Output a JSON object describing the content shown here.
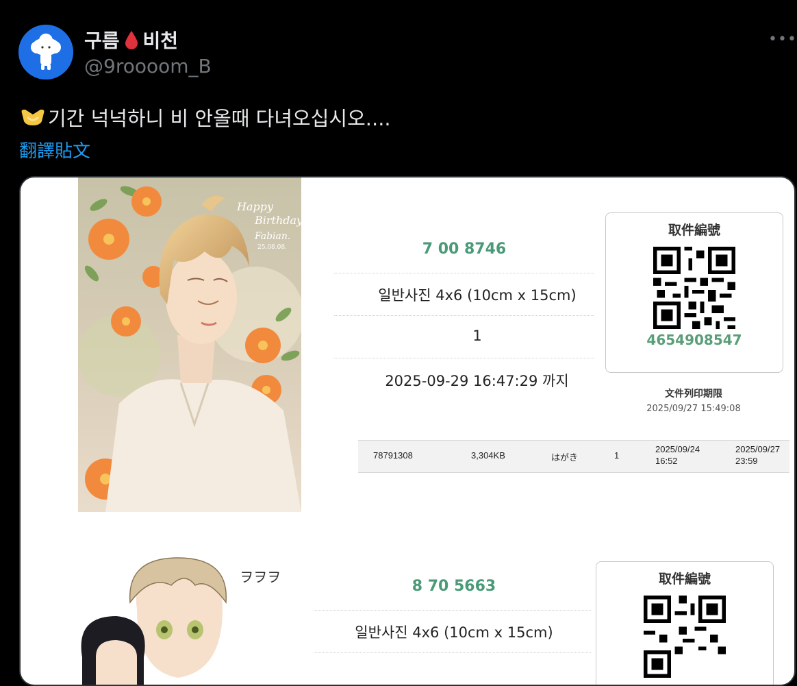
{
  "tweet": {
    "display_name_part1": "구름",
    "display_name_part2": "비천",
    "handle": "@9roooom_B",
    "text": "기간 넉넉하니 비 안올때 다녀오십시오....",
    "translate_label": "翻譯貼文",
    "more_icon": "more-dots-icon",
    "heart_color": "#f5c742"
  },
  "receipt1": {
    "code": "7 00 8746",
    "product": "일반사진 4x6 (10cm x 15cm)",
    "quantity": "1",
    "deadline": "2025-09-29 16:47:29 까지",
    "qr_title": "取件編號",
    "qr_number": "4654908547",
    "print_deadline_label": "文件列印期限",
    "print_deadline": "2025/09/27 15:49:08",
    "table": {
      "id": "78791308",
      "size": "3,304KB",
      "type": "はがき",
      "count": "1",
      "date1_a": "2025/09/24",
      "date1_b": "16:52",
      "date2_a": "2025/09/27",
      "date2_b": "23:59"
    },
    "art_text_1": "Happy",
    "art_text_2": "Birthday",
    "art_text_3": "Fabian.",
    "art_text_4": "25.08.08."
  },
  "receipt2": {
    "code": "8 70 5663",
    "product": "일반사진 4x6 (10cm x 15cm)",
    "qr_title": "取件編號",
    "art_text": "ヲヲヲ"
  }
}
